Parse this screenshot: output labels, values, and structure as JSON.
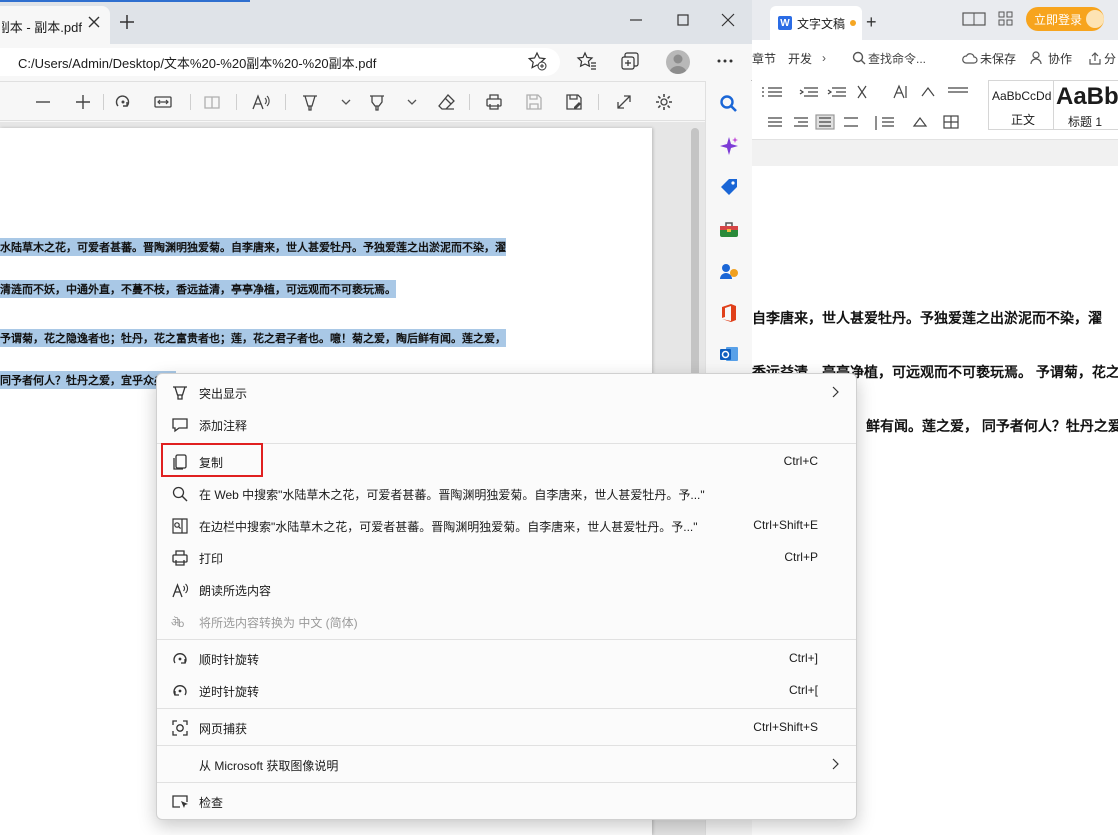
{
  "wps": {
    "tab_title": "文字文稿",
    "login_button": "立即登录",
    "menu": [
      "章节",
      "开发"
    ],
    "search_placeholder": "查找命令...",
    "unsaved": "未保存",
    "collaborate": "协作",
    "share": "分",
    "style_normal_preview": "AaBbCcDd",
    "style_normal_name": "正文",
    "style_h1_preview": "AaBb",
    "style_h1_name": "标题 1",
    "doc_lines": [
      "自李唐来，世人甚爱牡丹。予独爱莲之出淤泥而不染，濯",
      "香远益清，亭亭净植，可远观而不可亵玩焉。 予谓菊，花之隐逸者",
      "鲜有闻。莲之爱，  同予者何人？牡丹之爱"
    ]
  },
  "edge": {
    "tab_title": "文本 - 副本 - 副本.pdf",
    "url": "C:/Users/Admin/Desktop/文本%20-%20副本%20-%20副本.pdf",
    "pdf_lines": [
      "水陆草木之花，可爱者甚蕃。晋陶渊明独爱菊。自李唐来，世人甚爱牡丹。予独爱莲之出淤泥而不染，濯",
      "清涟而不妖，中通外直，不蔓不枝，香远益清，亭亭净植，可远观而不可亵玩焉。",
      "予谓菊，花之隐逸者也；牡丹，花之富贵者也；莲，花之君子者也。噫！菊之爱，陶后鲜有闻。莲之爱，",
      "同予者何人？牡丹之爱，宜乎众矣。"
    ]
  },
  "context_menu": {
    "items": [
      {
        "label": "突出显示",
        "shortcut": "",
        "icon": "highlighter-icon",
        "submenu": true
      },
      {
        "label": "添加注释",
        "shortcut": "",
        "icon": "comment-icon"
      },
      {
        "label": "复制",
        "shortcut": "Ctrl+C",
        "icon": "copy-icon"
      },
      {
        "label": "在 Web 中搜索\"水陆草木之花，可爱者甚蕃。晋陶渊明独爱菊。自李唐来，世人甚爱牡丹。予...\"",
        "shortcut": "",
        "icon": "search-icon"
      },
      {
        "label": "在边栏中搜索\"水陆草木之花，可爱者甚蕃。晋陶渊明独爱菊。自李唐来，世人甚爱牡丹。予...\"",
        "shortcut": "Ctrl+Shift+E",
        "icon": "sidebar-search-icon"
      },
      {
        "label": "打印",
        "shortcut": "Ctrl+P",
        "icon": "print-icon"
      },
      {
        "label": "朗读所选内容",
        "shortcut": "",
        "icon": "read-aloud-icon"
      },
      {
        "label": "将所选内容转换为 中文 (简体)",
        "shortcut": "",
        "icon": "translate-icon",
        "disabled": true
      },
      {
        "label": "顺时针旋转",
        "shortcut": "Ctrl+]",
        "icon": "rotate-cw-icon"
      },
      {
        "label": "逆时针旋转",
        "shortcut": "Ctrl+[",
        "icon": "rotate-ccw-icon"
      },
      {
        "label": "网页捕获",
        "shortcut": "Ctrl+Shift+S",
        "icon": "web-capture-icon"
      },
      {
        "label": "从 Microsoft 获取图像说明",
        "shortcut": "",
        "icon": "",
        "submenu": true
      },
      {
        "label": "检查",
        "shortcut": "",
        "icon": "inspect-icon"
      }
    ]
  },
  "colors": {
    "selection": "#a9c8e6",
    "highlight_box": "#e02020",
    "wps_login": "#f7a41d",
    "edge_accent": "#2f6fcf"
  }
}
